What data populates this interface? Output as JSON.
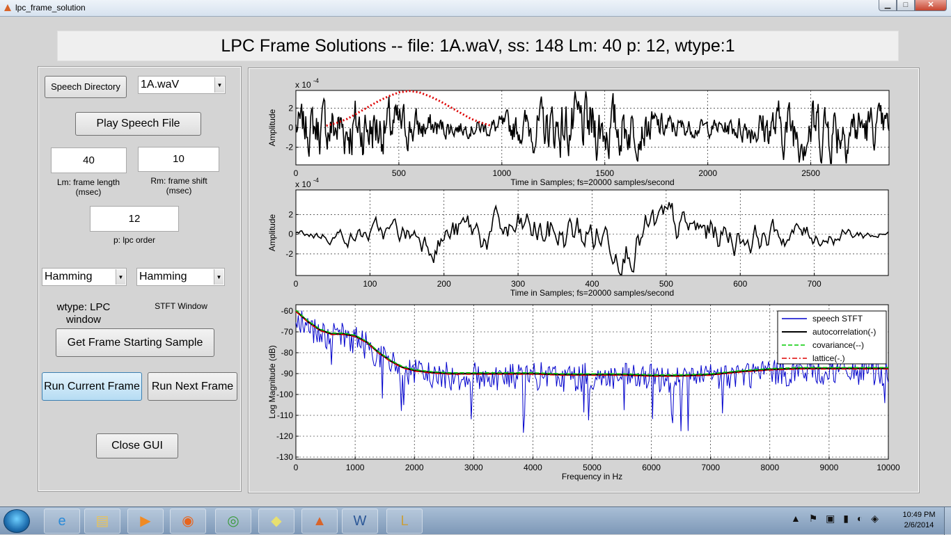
{
  "window": {
    "title": "lpc_frame_solution",
    "minimize_icon": "minimize-icon",
    "maximize_icon": "maximize-icon",
    "close_icon": "close-icon"
  },
  "header": {
    "title": "LPC Frame Solutions -- file: 1A.waV, ss: 148 Lm: 40 p: 12, wtype:1"
  },
  "controls": {
    "speech_directory_label": "Speech Directory",
    "file_select_value": "1A.waV",
    "play_button_label": "Play Speech File",
    "lm_value": "40",
    "lm_label_1": "Lm: frame length",
    "lm_label_2": "(msec)",
    "rm_value": "10",
    "rm_label_1": "Rm: frame shift",
    "rm_label_2": "(msec)",
    "p_value": "12",
    "p_label": "p: lpc order",
    "lpc_window_value": "Hamming",
    "stft_window_value": "Hamming",
    "wtype_label_1": "wtype: LPC",
    "wtype_label_2": "window",
    "stft_window_label": "STFT Window",
    "get_frame_label": "Get Frame Starting Sample",
    "run_current_label": "Run Current Frame",
    "run_next_label": "Run Next Frame",
    "close_gui_label": "Close GUI"
  },
  "chart_data": [
    {
      "type": "line",
      "ylabel": "Amplitude",
      "xlabel": "Time in Samples; fs=20000 samples/second",
      "exponent_label": "x 10",
      "exponent": "-4",
      "xlim": [
        0,
        2880
      ],
      "ylim": [
        -3.8,
        3.8
      ],
      "xticks": [
        0,
        500,
        1000,
        1500,
        2000,
        2500
      ],
      "yticks": [
        -2,
        0,
        2
      ],
      "grid": true,
      "series": [
        {
          "color": "#000000",
          "style": "solid"
        },
        {
          "color": "#dd0000",
          "style": "dotted",
          "x": [
            148,
            200,
            250,
            300,
            350,
            400,
            450,
            500,
            550,
            600,
            650,
            700,
            750,
            800,
            850,
            900,
            948
          ],
          "values": [
            0.2,
            0.5,
            0.9,
            1.5,
            2.1,
            2.7,
            3.2,
            3.6,
            3.75,
            3.6,
            3.2,
            2.7,
            2.1,
            1.5,
            0.9,
            0.5,
            0.2
          ]
        }
      ]
    },
    {
      "type": "line",
      "ylabel": "Amplitude",
      "xlabel": "Time in Samples; fs=20000 samples/second",
      "exponent_label": "x 10",
      "exponent": "-4",
      "xlim": [
        0,
        800
      ],
      "ylim": [
        -4.2,
        4.5
      ],
      "xticks": [
        0,
        100,
        200,
        300,
        400,
        500,
        600,
        700
      ],
      "yticks": [
        -2,
        0,
        2
      ],
      "grid": true,
      "series": [
        {
          "color": "#000000",
          "style": "solid"
        }
      ]
    },
    {
      "type": "line",
      "ylabel": "Log Magnitude (dB)",
      "xlabel": "Frequency in Hz",
      "xlim": [
        0,
        10000
      ],
      "ylim": [
        -131,
        -57
      ],
      "xticks": [
        0,
        1000,
        2000,
        3000,
        4000,
        5000,
        6000,
        7000,
        8000,
        9000,
        10000
      ],
      "yticks": [
        -130,
        -120,
        -110,
        -100,
        -90,
        -80,
        -70,
        -60
      ],
      "grid": true,
      "legend_position": "top-right",
      "envelope": {
        "x": [
          0,
          200,
          400,
          600,
          800,
          1000,
          1200,
          1400,
          1600,
          1800,
          2000,
          2300,
          2600,
          3000,
          3500,
          4000,
          4500,
          5000,
          5500,
          6000,
          6500,
          7000,
          7500,
          8000,
          8500,
          9000,
          9500,
          10000
        ],
        "values": [
          -60,
          -65,
          -69,
          -71,
          -71,
          -72,
          -75,
          -80,
          -84,
          -87,
          -88.5,
          -89.5,
          -90,
          -90,
          -90,
          -90,
          -90.5,
          -90.5,
          -90.5,
          -91,
          -91,
          -90.5,
          -89,
          -88,
          -87.5,
          -87.5,
          -87.5,
          -87.5
        ]
      },
      "series": [
        {
          "name": "speech STFT",
          "color": "#0000cc",
          "style": "solid"
        },
        {
          "name": "autocorrelation(-)",
          "color": "#000000",
          "style": "solid"
        },
        {
          "name": "covariance(--)",
          "color": "#00cc00",
          "style": "dashed"
        },
        {
          "name": "lattice(-.)",
          "color": "#dd0000",
          "style": "dashdot"
        }
      ]
    }
  ],
  "taskbar": {
    "apps": [
      {
        "name": "internet-explorer-icon",
        "glyph": "e",
        "color": "#2a8ad8"
      },
      {
        "name": "file-explorer-icon",
        "glyph": "▤",
        "color": "#e8c35a"
      },
      {
        "name": "media-player-icon",
        "glyph": "▶",
        "color": "#f08a24"
      },
      {
        "name": "firefox-icon",
        "glyph": "◉",
        "color": "#e8641c"
      },
      {
        "name": "chrome-icon",
        "glyph": "◎",
        "color": "#3a9b3a"
      },
      {
        "name": "sticky-notes-icon",
        "glyph": "◆",
        "color": "#e8e070"
      },
      {
        "name": "matlab-icon",
        "glyph": "▲",
        "color": "#d8642a"
      },
      {
        "name": "word-icon",
        "glyph": "W",
        "color": "#2b5797"
      },
      {
        "name": "league-icon",
        "glyph": "L",
        "color": "#c8a040"
      }
    ],
    "tray_text": "▲ ⚑ ▣ ▮ ◐ ◈",
    "time": "10:49 PM",
    "date": "2/6/2014"
  }
}
